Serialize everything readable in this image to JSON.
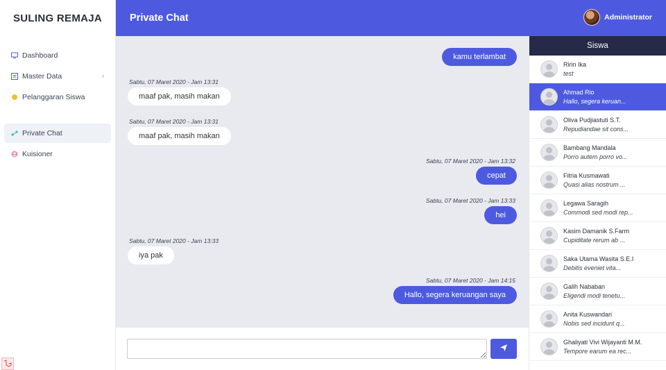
{
  "brand": "SULING REMAJA",
  "sidebar": {
    "items": [
      {
        "label": "Dashboard",
        "icon": "monitor-icon"
      },
      {
        "label": "Master Data",
        "icon": "table-icon"
      },
      {
        "label": "Pelanggaran Siswa",
        "icon": "dot-yellow-icon"
      },
      {
        "label": "Private Chat",
        "icon": "share-icon",
        "active": true
      },
      {
        "label": "Kuisioner",
        "icon": "user-circle-icon"
      }
    ]
  },
  "header": {
    "title": "Private Chat",
    "user": "Administrator"
  },
  "messages": [
    {
      "text": "kamu terlambat",
      "time": "",
      "from": "me"
    },
    {
      "text": "maaf pak, masih makan",
      "time": "Sabtu, 07 Maret 2020 - Jam 13:31",
      "from": "other"
    },
    {
      "text": "maaf pak, masih makan",
      "time": "Sabtu, 07 Maret 2020 - Jam 13:31",
      "from": "other"
    },
    {
      "text": "cepat",
      "time": "Sabtu, 07 Maret 2020 - Jam 13:32",
      "from": "me"
    },
    {
      "text": "hei",
      "time": "Sabtu, 07 Maret 2020 - Jam 13:33",
      "from": "me"
    },
    {
      "text": "iya pak",
      "time": "Sabtu, 07 Maret 2020 - Jam 13:33",
      "from": "other"
    },
    {
      "text": "Hallo, segera keruangan saya",
      "time": "Sabtu, 07 Maret 2020 - Jam 14:15",
      "from": "me"
    }
  ],
  "composer": {
    "value": "",
    "placeholder": ""
  },
  "students": {
    "title": "Siswa",
    "items": [
      {
        "name": "Ririn Ika",
        "last": "test"
      },
      {
        "name": "Ahmad Rio",
        "last": "Hallo, segera keruan...",
        "active": true
      },
      {
        "name": "Oliva Pudjiastuti S.T.",
        "last": "Repudiandae sit cons..."
      },
      {
        "name": "Bambang Mandala",
        "last": "Porro autem porro vo..."
      },
      {
        "name": "Fitria Kusmawati",
        "last": "Quasi alias nostrum ..."
      },
      {
        "name": "Legawa Saragih",
        "last": "Commodi sed modi rep..."
      },
      {
        "name": "Kasim Damanik S.Farm",
        "last": "Cupiditate rerum ab ..."
      },
      {
        "name": "Saka Utama Wasita S.E.I",
        "last": "Debitis eveniet vita..."
      },
      {
        "name": "Galih Nababan",
        "last": "Eligendi modi tenetu..."
      },
      {
        "name": "Anita Kuswandari",
        "last": "Nobis sed incidunt q..."
      },
      {
        "name": "Ghaliyati Vivi Wijayanti M.M.",
        "last": "Tempore earum ea rec..."
      }
    ]
  },
  "colors": {
    "primary": "#4d5ae0",
    "list_header": "#262a48",
    "chat_bg": "#e8eaf0"
  }
}
